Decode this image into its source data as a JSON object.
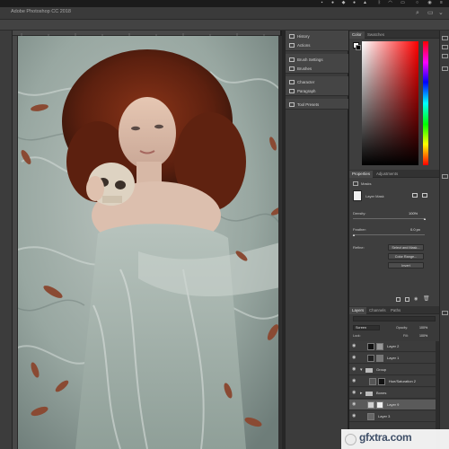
{
  "app": {
    "title": "Adobe Photoshop CC 2018"
  },
  "dock": {
    "items": [
      {
        "label": "History",
        "icon": "history-icon"
      },
      {
        "label": "Actions",
        "icon": "play-icon"
      },
      {
        "label": "Brush Settings",
        "icon": "brush-icon"
      },
      {
        "label": "Brushes",
        "icon": "brushes-icon"
      },
      {
        "label": "Character",
        "icon": "character-icon"
      },
      {
        "label": "Paragraph",
        "icon": "paragraph-icon"
      },
      {
        "label": "Tool Presets",
        "icon": "tool-presets-icon"
      }
    ]
  },
  "color_panel": {
    "tabs": [
      "Color",
      "Swatches"
    ]
  },
  "properties_panel": {
    "tabs": [
      "Properties",
      "Adjustments"
    ],
    "masks_label": "Masks",
    "layer_mask_label": "Layer Mask",
    "density_label": "Density:",
    "density_value": "100%",
    "feather_label": "Feather:",
    "feather_value": "0.0 px",
    "refine_label": "Refine:",
    "buttons": [
      "Select and Mask...",
      "Color Range...",
      "Invert"
    ]
  },
  "layers_panel": {
    "tabs": [
      "Layers",
      "Channels",
      "Paths"
    ],
    "blend_mode": "Screen",
    "opacity_label": "Opacity:",
    "opacity_value": "100%",
    "lock_label": "Lock:",
    "fill_label": "Fill:",
    "fill_value": "100%",
    "layers": [
      {
        "name": "Layer 2",
        "selected": false
      },
      {
        "name": "Layer 1",
        "selected": false
      },
      {
        "name": "Group",
        "selected": false
      },
      {
        "name": "Hue/Saturation 2",
        "selected": false
      },
      {
        "name": "Bones",
        "selected": false
      },
      {
        "name": "Layer 9",
        "selected": true
      },
      {
        "name": "Layer 3",
        "selected": false
      }
    ]
  },
  "watermark": {
    "text": "gfxtra.com"
  }
}
